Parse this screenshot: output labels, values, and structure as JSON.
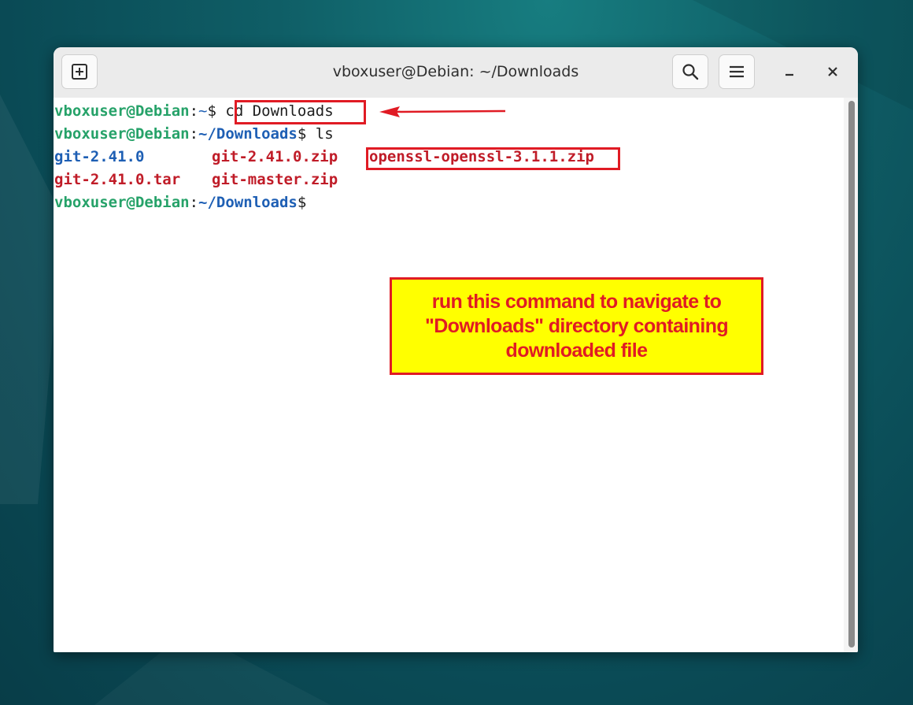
{
  "window": {
    "title": "vboxuser@Debian: ~/Downloads"
  },
  "titlebar": {
    "new_tab_icon": "new-tab-icon",
    "search_icon": "search-icon",
    "menu_icon": "hamburger-menu-icon",
    "minimize_icon": "minimize-icon",
    "close_icon": "close-icon"
  },
  "terminal": {
    "line1": {
      "user_host": "vboxuser@Debian",
      "sep": ":",
      "path": "~",
      "prompt": "$ ",
      "command": "cd Downloads"
    },
    "line2": {
      "user_host": "vboxuser@Debian",
      "sep": ":",
      "path": "~/Downloads",
      "prompt": "$ ",
      "command": "ls"
    },
    "ls_output": {
      "row1": [
        "git-2.41.0",
        "git-2.41.0.zip",
        "openssl-openssl-3.1.1.zip"
      ],
      "row2": [
        "git-2.41.0.tar",
        "git-master.zip"
      ]
    },
    "line5": {
      "user_host": "vboxuser@Debian",
      "sep": ":",
      "path": "~/Downloads",
      "prompt": "$"
    }
  },
  "annotation": {
    "callout_text": "run this command to navigate to\n\"Downloads\" directory containing\ndownloaded file",
    "box_color": "#e01b24",
    "callout_bg": "#ffff00"
  },
  "colors": {
    "user_host": "#26a269",
    "path": "#1e5fb4",
    "directory": "#1e5fb4",
    "archive": "#c01c28"
  }
}
